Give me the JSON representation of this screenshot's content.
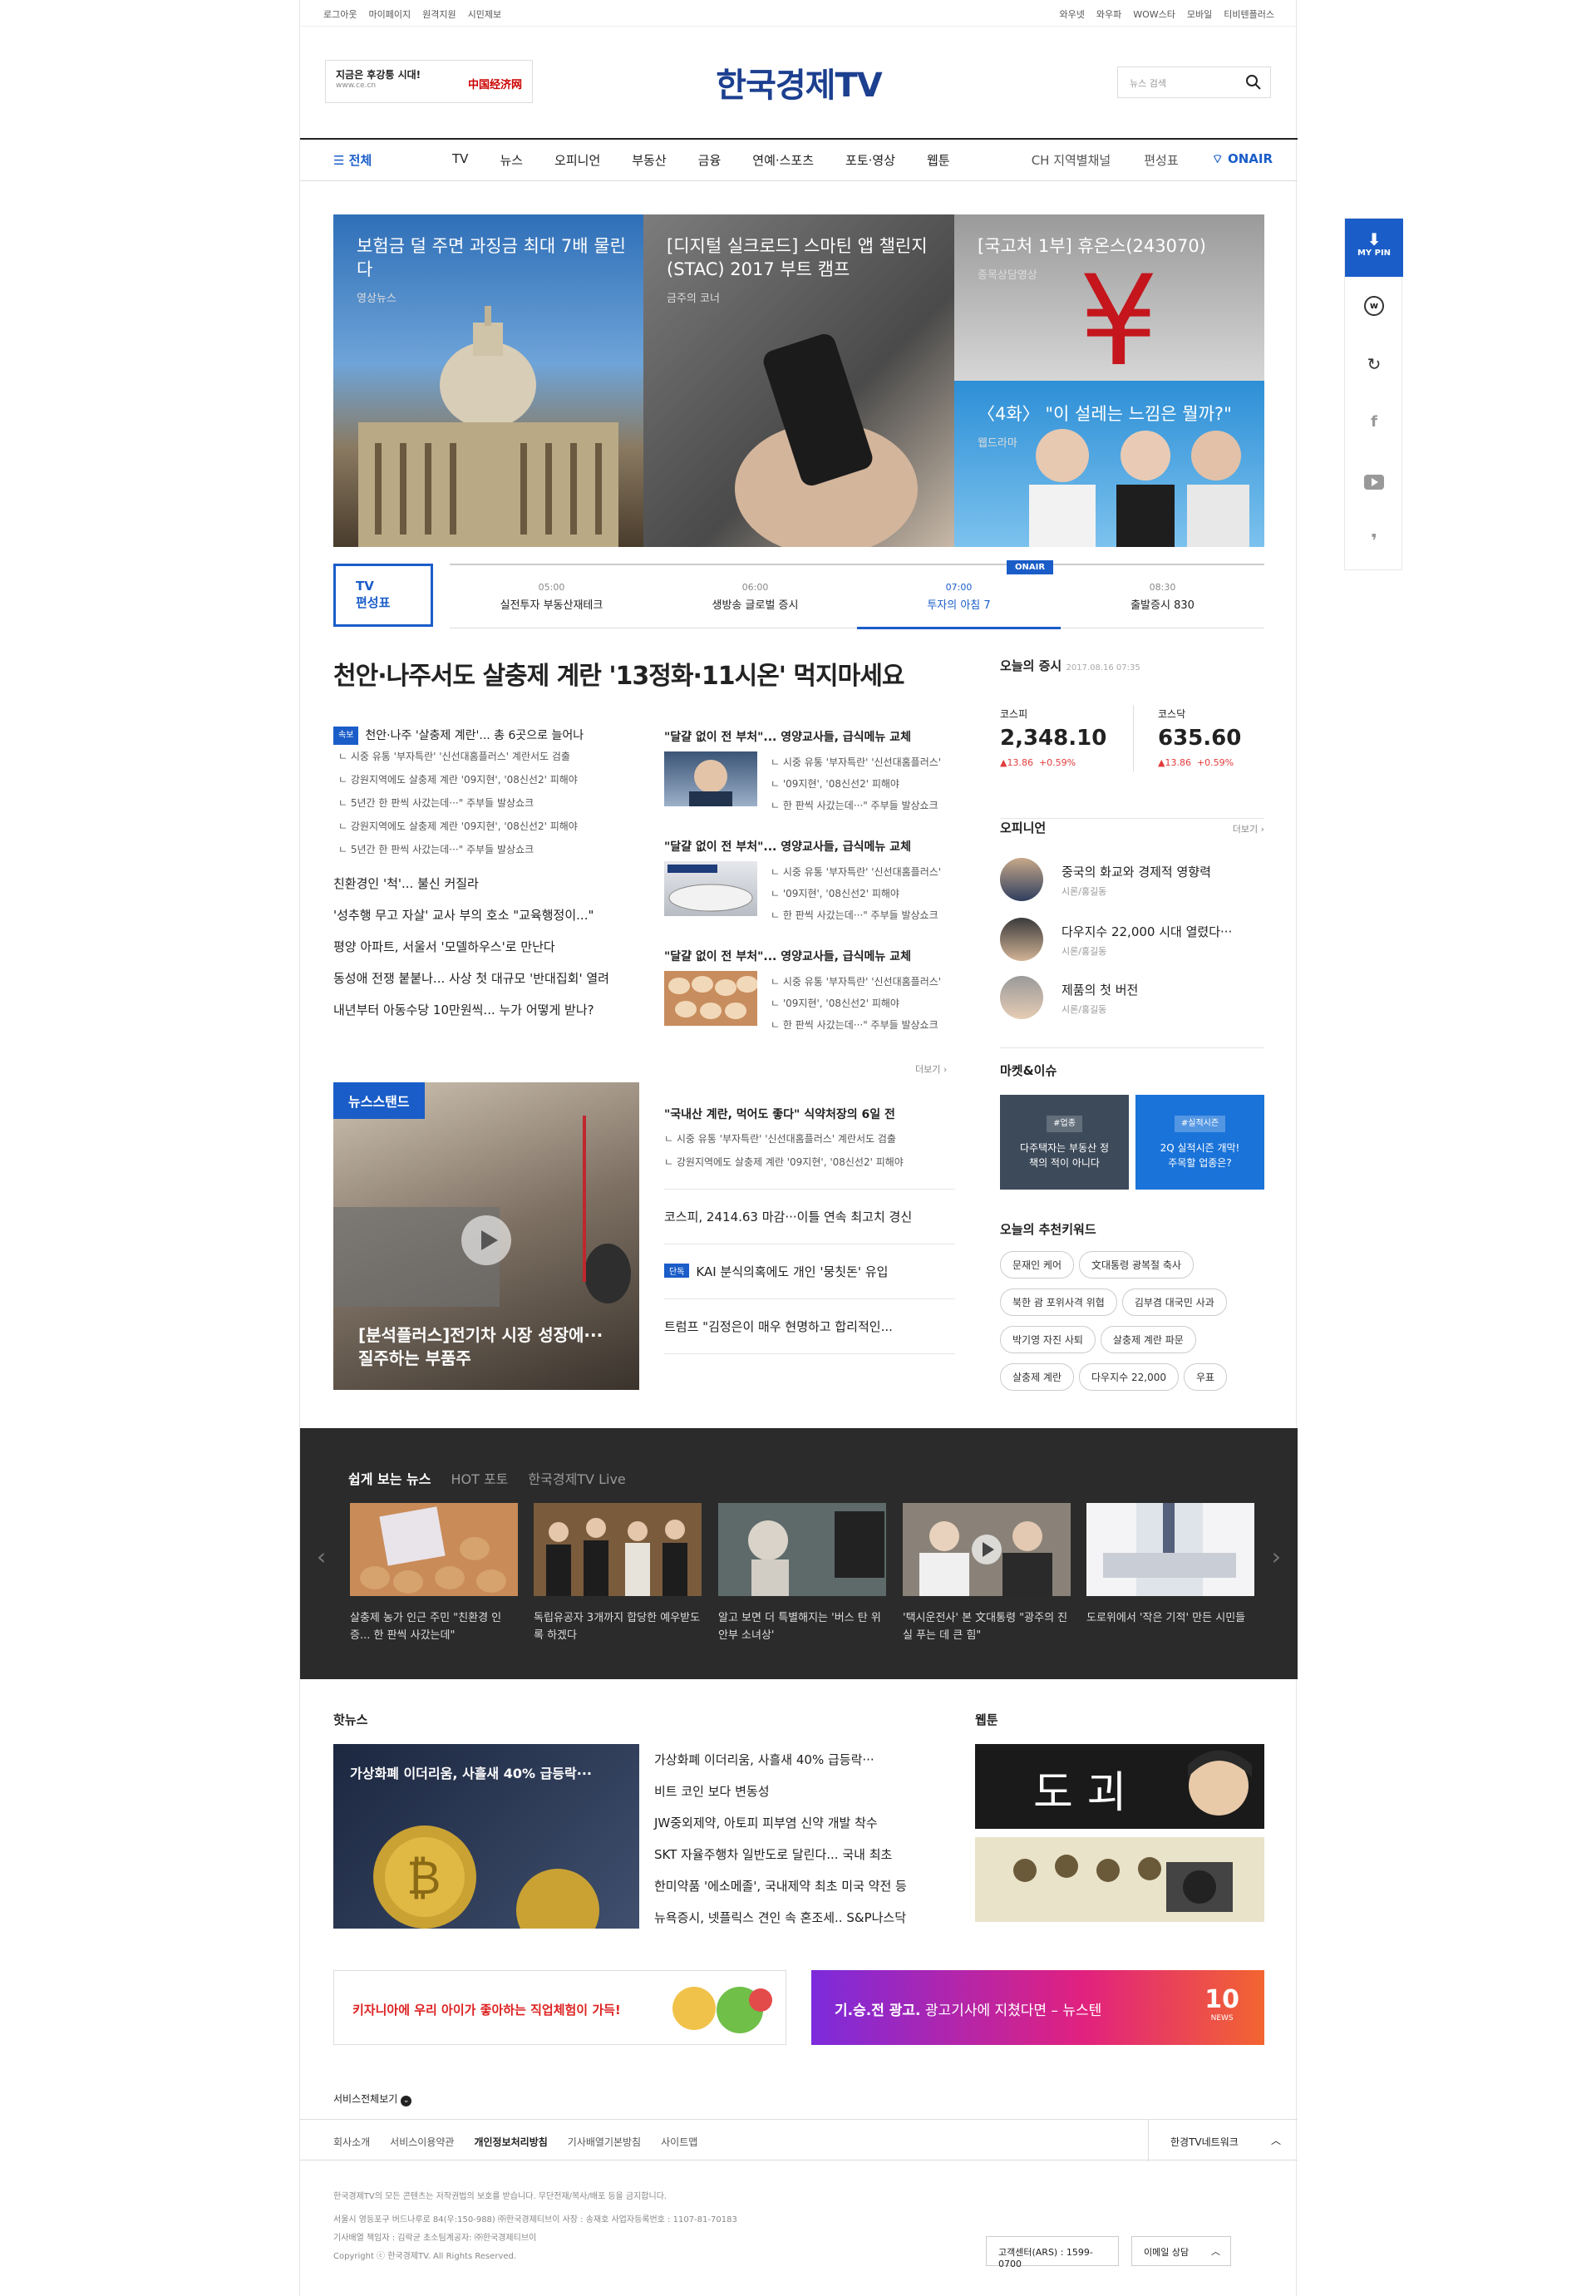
{
  "util": {
    "left": [
      "로그아웃",
      "마이페이지",
      "원격지원",
      "시민제보"
    ],
    "right": [
      "와우넷",
      "와우파",
      "WOW스타",
      "모바일",
      "티비텐플러스"
    ]
  },
  "ad": {
    "line1": "지금은 후강퉁 시대!",
    "line2": "www.ce.cn",
    "logo": "中国经济网"
  },
  "brand": "한국경제TV",
  "search": {
    "placeholder": "뉴스 검색"
  },
  "gnb": {
    "all": "전체",
    "menu": [
      "TV",
      "뉴스",
      "오피니언",
      "부동산",
      "금융",
      "연예·스포츠",
      "포토·영상",
      "웹툰"
    ],
    "right": [
      "CH 지역별채널",
      "편성표",
      "ONAIR"
    ]
  },
  "hero": [
    {
      "title": "보험금 덜 주면 과징금 최대 7배 물린다",
      "sub": "영상뉴스"
    },
    {
      "title": "[디지털 실크로드] 스마틴 앱 챌린지(STAC) 2017 부트 캠프",
      "sub": "금주의 코너"
    },
    {
      "title": "[국고처 1부] 휴온스(243070)",
      "sub": "종목상담영상"
    },
    {
      "title": "〈4화〉 \"이 설레는 느낌은 뭘까?\"",
      "sub": "웹드라마"
    }
  ],
  "side_quick": {
    "mypin": "MY PIN"
  },
  "schedule": {
    "badge1": "TV",
    "badge2": "편성표",
    "onair": "ONAIR",
    "items": [
      {
        "time": "05:00",
        "title": "실전투자 부동산재테크"
      },
      {
        "time": "06:00",
        "title": "생방송 글로벌 증시"
      },
      {
        "time": "07:00",
        "title": "투자의 아침 7"
      },
      {
        "time": "08:30",
        "title": "출발증시 830"
      }
    ]
  },
  "headline": "천안·나주서도 살충제 계란 '13정화·11시온' 먹지마세요",
  "left_list": {
    "tag": "속보",
    "top": "천안·나주 '살충제 계란'... 총 6곳으로 늘어나",
    "subs": [
      "시중 유통 '부자특란' '신선대홈플러스' 계란서도 검출",
      "강원지역에도 살충제 계란 '09지현', '08신선2' 피해야",
      "5년간 한 판씩 사갔는데···\" 주부들 발상쇼크",
      "강원지역에도 살충제 계란 '09지현', '08신선2' 피해야",
      "5년간 한 판씩 사갔는데···\" 주부들 발상쇼크"
    ],
    "big": [
      "친환경인 '척'... 불신 커질라",
      "'성추행 무고 자살' 교사 부의 호소 \"교육행정이...\"",
      "평양 아파트, 서울서 '모델하우스'로 만난다",
      "동성애 전쟁 붙붙나... 사상 첫 대규모 '반대집회' 열려",
      "내년부터 아동수당 10만원씩... 누가 어떻게 받나?"
    ]
  },
  "mid_articles": [
    {
      "title": "\"달걀 없이 전 부처\"... 영양교사들, 급식메뉴 교체",
      "subs": [
        "시중 유통 '부자특란' '신선대홈플러스'",
        "'09지현', '08신선2' 피해야",
        "한 판씩 사갔는데···\" 주부들 발상쇼크"
      ]
    },
    {
      "title": "\"달걀 없이 전 부처\"... 영양교사들, 급식메뉴 교체",
      "subs": [
        "시중 유통 '부자특란' '신선대홈플러스'",
        "'09지현', '08신선2' 피해야",
        "한 판씩 사갔는데···\" 주부들 발상쇼크"
      ]
    },
    {
      "title": "\"달걀 없이 전 부처\"... 영양교사들, 급식메뉴 교체",
      "subs": [
        "시중 유통 '부자특란' '신선대홈플러스'",
        "'09지현', '08신선2' 피해야",
        "한 판씩 사갔는데···\" 주부들 발상쇼크"
      ]
    }
  ],
  "more": "더보기",
  "newsstand": {
    "label": "뉴스스탠드",
    "caption": "[분석플러스]전기차 시장 성장에··· 질주하는 부품주"
  },
  "ns_list": {
    "first": "\"국내산 계란, 먹어도 좋다\" 식약처장의 6일 전",
    "subs": [
      "시중 유통 '부자특란' '신선대홈플러스' 계란서도 검출",
      "강원지역에도 살충제 계란 '09지현', '08신선2' 피해야"
    ],
    "items": [
      "코스피, 2414.63 마감···이틀 연속 최고치 경신",
      "KAI 분식의혹에도 개인 '뭉칫돈' 유입",
      "트럼프 \"김정은이 매우 현명하고 합리적인..."
    ],
    "tag": "단독"
  },
  "stock": {
    "title": "오늘의 증시",
    "date": "2017.08.16 07:35",
    "kospi": {
      "name": "코스피",
      "value": "2,348.10",
      "chg": "▲13.86",
      "pct": "+0.59%"
    },
    "kosdaq": {
      "name": "코스닥",
      "value": "635.60",
      "chg": "▲13.86",
      "pct": "+0.59%"
    }
  },
  "opinion": {
    "title": "오피니언",
    "more": "더보기",
    "items": [
      {
        "title": "중국의 화교와 경제적 영향력",
        "by": "시론/홍길동"
      },
      {
        "title": "다우지수 22,000 시대 열렸다···",
        "by": "시론/홍길동"
      },
      {
        "title": "제품의 첫 버전",
        "by": "시론/홍길동"
      }
    ]
  },
  "market": {
    "title": "마켓&이슈",
    "cards": [
      {
        "tag": "#업종",
        "text": "다주택자는 부동산 정책의 적이 아니다"
      },
      {
        "tag": "#실적시즌",
        "text": "2Q 실적시즌 개막! 주목할 업종은?"
      }
    ]
  },
  "keywords": {
    "title": "오늘의 추천키워드",
    "items": [
      "문재인 케어",
      "文대통령 광복절 축사",
      "북한 괌 포위사격 위협",
      "김부겸 대국민 사과",
      "박기영 자진 사퇴",
      "살충제 계란 파문",
      "살충제 계란",
      "다우지수 22,000",
      "우표"
    ]
  },
  "dark": {
    "tabs": [
      "쉽게 보는 뉴스",
      "HOT 포토",
      "한국경제TV Live"
    ],
    "cards": [
      "살충제 농가 인근 주민 \"친환경 인증... 한 판씩 사갔는데\"",
      "독립유공자 3개까지 합당한 예우받도록 하겠다",
      "알고 보면 더 특별해지는 '버스 탄 위안부 소녀상'",
      "'택시운전사' 본 文대통령 \"광주의 진실 푸는 데 큰 힘\"",
      "도로위에서 '작은 기적' 만든 시민들"
    ]
  },
  "hotnews": {
    "title": "핫뉴스",
    "img_caption": "가상화폐 이더리움, 사흘새 40% 급등락···",
    "items": [
      "가상화폐 이더리움, 사흘새 40% 급등락···",
      "비트 코인 보다 변동성",
      "JW중외제약, 아토피 피부염 신약 개발 착수",
      "SKT 자율주행차 일반도로 달린다... 국내 최초",
      "한미약품 '에소메졸', 국내제약 최초 미국 약전 등",
      "뉴욕증시, 넷플릭스 견인 속 혼조세.. S&P나스닥"
    ]
  },
  "webtoon": {
    "title": "웹툰",
    "t1": "도 괴"
  },
  "banners": {
    "left": "키자니아에 우리 아이가 좋아하는 직업체험이 가득!",
    "right_a": "기.승.전 광고.",
    "right_b": " 광고기사에 지쳤다면 – 뉴스텐",
    "right_logo": "10",
    "right_logo2": "NEWS"
  },
  "service_all": "서비스전체보기",
  "footer": {
    "links": [
      "회사소개",
      "서비스이용약관",
      "개인정보처리방침",
      "기사배열기본방침",
      "사이트맵"
    ],
    "network": "한경TV네트워크",
    "notice": "한국경제TV의 모든 콘텐츠는 저작권법의 보호를 받습니다. 무단전재/복사/배포 등을 금지합니다.",
    "addr1": "서울시 영등포구 버드나루로 84(우:150-988) ㈜한국경제티브이   사장 : 송재호   사업자등록번호 : 1107-81-70183",
    "addr2": "기사배열 책임자 : 김락균   초소팀계공자: ㈜한국경제티브이",
    "copy": "Copyright ⓒ 한국경제TV. All Rights Reserved.",
    "cs": "고객센터(ARS) : 1599-0700",
    "email": "이메일 상담"
  }
}
